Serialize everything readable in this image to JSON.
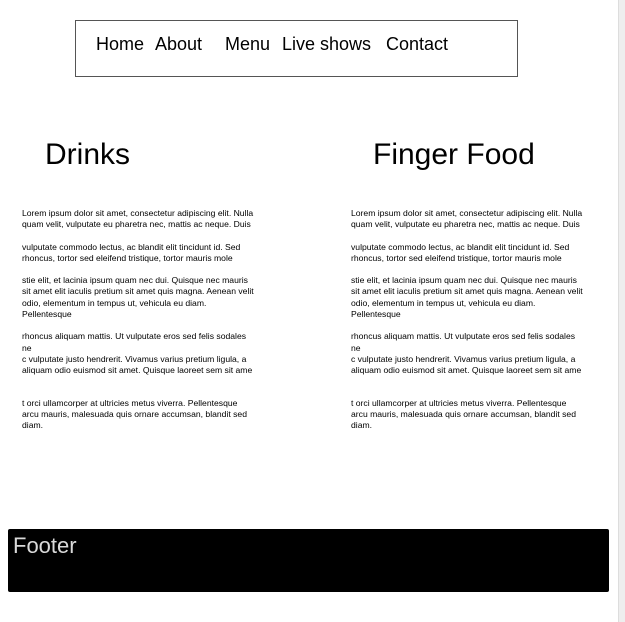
{
  "nav": {
    "items": [
      "Home",
      "About",
      "Menu",
      "Live shows",
      "Contact"
    ]
  },
  "columns": [
    {
      "title": "Drinks",
      "paragraphs": [
        "Lorem ipsum dolor sit amet, consectetur adipiscing elit. Nulla quam velit, vulputate eu pharetra nec, mattis ac neque. Duis",
        "vulputate commodo lectus, ac blandit elit tincidunt id. Sed rhoncus, tortor sed eleifend tristique, tortor mauris mole",
        "stie elit, et lacinia ipsum quam nec dui. Quisque nec mauris sit amet elit iaculis pretium sit amet quis magna. Aenean velit odio, elementum in tempus ut, vehicula eu diam. Pellentesque",
        "rhoncus aliquam mattis. Ut vulputate eros sed felis sodales ne",
        "c vulputate justo hendrerit. Vivamus varius pretium ligula, a aliquam odio euismod sit amet. Quisque laoreet sem sit ame",
        "t orci ullamcorper at ultricies metus viverra. Pellentesque arcu mauris, malesuada quis ornare accumsan, blandit sed diam."
      ]
    },
    {
      "title": "Finger Food",
      "paragraphs": [
        "Lorem ipsum dolor sit amet, consectetur adipiscing elit. Nulla quam velit, vulputate eu pharetra nec, mattis ac neque. Duis",
        "vulputate commodo lectus, ac blandit elit tincidunt id. Sed rhoncus, tortor sed eleifend tristique, tortor mauris mole",
        "stie elit, et lacinia ipsum quam nec dui. Quisque nec mauris sit amet elit iaculis pretium sit amet quis magna. Aenean velit odio, elementum in tempus ut, vehicula eu diam. Pellentesque",
        "rhoncus aliquam mattis. Ut vulputate eros sed felis sodales ne",
        "c vulputate justo hendrerit. Vivamus varius pretium ligula, a aliquam odio euismod sit amet. Quisque laoreet sem sit ame",
        "t orci ullamcorper at ultricies metus viverra. Pellentesque arcu mauris, malesuada quis ornare accumsan, blandit sed diam."
      ]
    }
  ],
  "footer": {
    "label": "Footer"
  },
  "colors": {
    "footer_bg": "#000000",
    "footer_text": "#d9d9d9",
    "nav_border": "#555555"
  }
}
